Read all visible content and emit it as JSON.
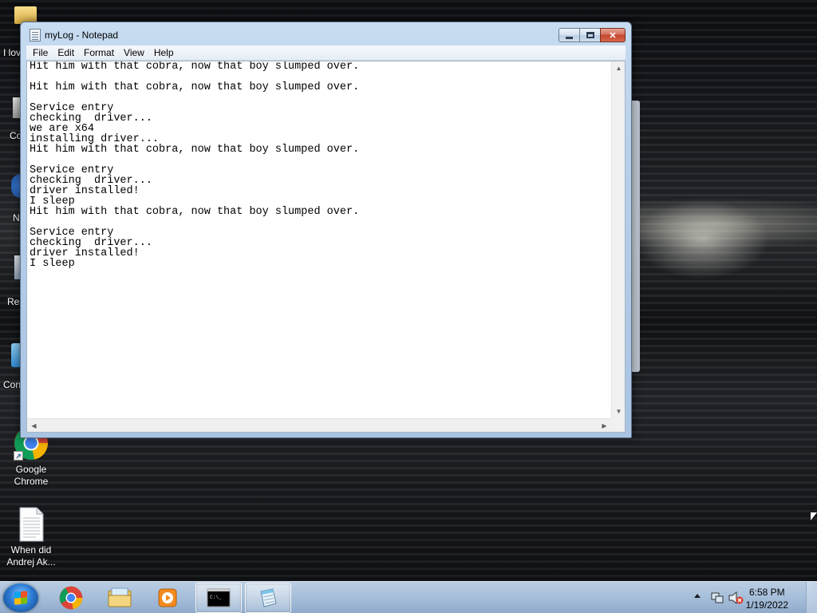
{
  "desktop": {
    "partial_labels": [
      "I lov",
      "Co",
      "N",
      "Rec",
      "Con"
    ],
    "icons": [
      {
        "label_line1": "Google",
        "label_line2": "Chrome"
      },
      {
        "label_line1": "When did",
        "label_line2": "Andrej Ak..."
      }
    ]
  },
  "notepad": {
    "title": "myLog - Notepad",
    "menu": [
      "File",
      "Edit",
      "Format",
      "View",
      "Help"
    ],
    "lines": [
      "Hit him with that cobra, now that boy slumped over.",
      "",
      "Hit him with that cobra, now that boy slumped over.",
      "",
      "Service entry",
      "checking  driver...",
      "we are x64",
      "installing driver...",
      "Hit him with that cobra, now that boy slumped over.",
      "",
      "Service entry",
      "checking  driver...",
      "driver installed!",
      "I sleep",
      "Hit him with that cobra, now that boy slumped over.",
      "",
      "Service entry",
      "checking  driver...",
      "driver installed!",
      "I sleep"
    ]
  },
  "taskbar": {
    "clock_time": "6:58 PM",
    "clock_date": "1/19/2022"
  },
  "colors": {
    "chrome_red": "#db4437",
    "chrome_green": "#0f9d58",
    "chrome_yellow": "#f4b400",
    "chrome_blue": "#4285f4",
    "close_red": "#c3452c"
  }
}
